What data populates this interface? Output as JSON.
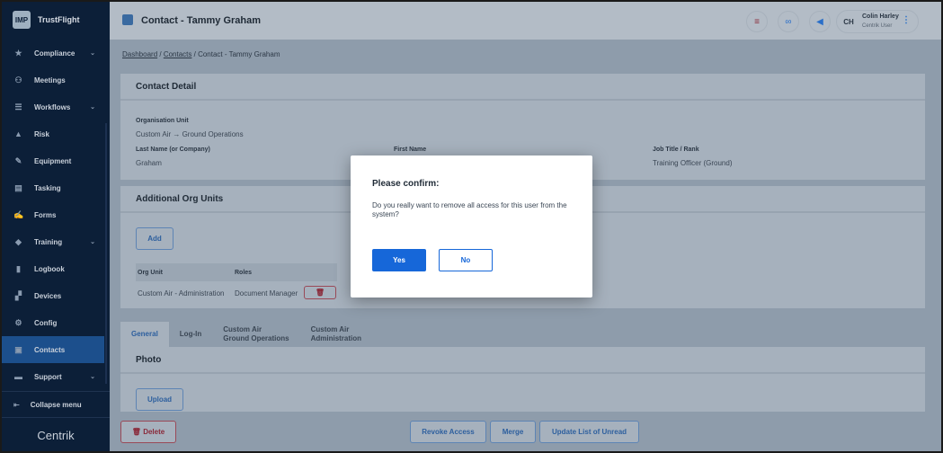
{
  "sidebar": {
    "logo_box": "IMP",
    "brand": "TrustFlight",
    "items": [
      {
        "label": "Compliance",
        "icon": "★",
        "chev": true
      },
      {
        "label": "Meetings",
        "icon": "⚇"
      },
      {
        "label": "Workflows",
        "icon": "☰",
        "chev": true
      },
      {
        "label": "Risk",
        "icon": "▲"
      },
      {
        "label": "Equipment",
        "icon": "✎"
      },
      {
        "label": "Tasking",
        "icon": "▤"
      },
      {
        "label": "Forms",
        "icon": "✍"
      },
      {
        "label": "Training",
        "icon": "◆",
        "chev": true
      },
      {
        "label": "Logbook",
        "icon": "▮"
      },
      {
        "label": "Devices",
        "icon": "▞"
      },
      {
        "label": "Config",
        "icon": "⚙"
      },
      {
        "label": "Contacts",
        "icon": "▣",
        "active": true
      },
      {
        "label": "Support",
        "icon": "▬",
        "chev": true
      }
    ],
    "collapse": "Collapse menu",
    "footer_logo": "Centrik"
  },
  "header": {
    "title": "Contact - Tammy Graham",
    "user_initials": "CH",
    "user_name": "Colin Harley",
    "user_role": "Centrik User"
  },
  "breadcrumb": {
    "items": [
      "Dashboard",
      "Contacts"
    ],
    "current": "Contact - Tammy Graham"
  },
  "contact_detail": {
    "title": "Contact Detail",
    "org_unit_label": "Organisation Unit",
    "org_unit": "Custom Air → Ground Operations",
    "last_name_label": "Last Name (or Company)",
    "last_name": "Graham",
    "first_name_label": "First Name",
    "job_title_label": "Job Title / Rank",
    "job_title": "Training Officer (Ground)"
  },
  "org_units": {
    "title": "Additional Org Units",
    "add": "Add",
    "col_org": "Org Unit",
    "col_roles": "Roles",
    "row_org": "Custom Air - Administration",
    "row_roles": "Document Manager"
  },
  "tabs": [
    "General",
    "Log-In",
    "Custom Air\nGround Operations",
    "Custom Air\nAdministration"
  ],
  "photo": {
    "title": "Photo",
    "upload": "Upload"
  },
  "footer": {
    "delete": "Delete",
    "revoke": "Revoke Access",
    "merge": "Merge",
    "update": "Update List of Unread"
  },
  "modal": {
    "title": "Please confirm:",
    "body": "Do you really want to remove all access for this user from the system?",
    "yes": "Yes",
    "no": "No"
  }
}
